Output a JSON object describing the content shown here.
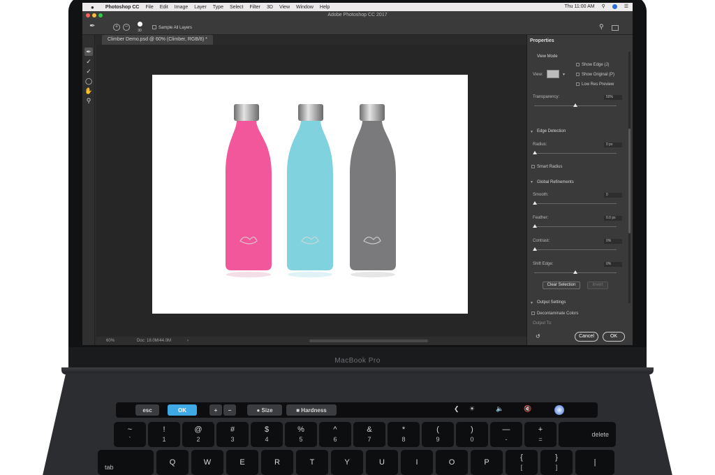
{
  "menubar": {
    "apple": "",
    "app_name": "Photoshop CC",
    "items": [
      "File",
      "Edit",
      "Image",
      "Layer",
      "Type",
      "Select",
      "Filter",
      "3D",
      "View",
      "Window",
      "Help"
    ],
    "clock": "Thu 11:00 AM"
  },
  "window": {
    "title": "Adobe Photoshop CC 2017",
    "light_colors": [
      "#fc605b",
      "#fdbc40",
      "#34c84a"
    ]
  },
  "options_bar": {
    "brush_size": "30",
    "sample_all_layers": "Sample All Layers"
  },
  "tools": [
    "quick-selection",
    "refine-edge-brush",
    "brush",
    "lasso",
    "hand",
    "zoom"
  ],
  "document": {
    "tab_title": "Climber Demo.psd @ 60% (Climber, RGB/8) *",
    "zoom": "60%",
    "doc_info": "Doc: 18.0M/44.0M"
  },
  "canvas": {
    "bottles": [
      {
        "name": "pink",
        "color": "#f1579a"
      },
      {
        "name": "teal",
        "color": "#7fd2de"
      },
      {
        "name": "gray",
        "color": "#7a7a7c"
      }
    ]
  },
  "properties": {
    "title": "Properties",
    "view_mode": {
      "heading": "View Mode",
      "view_label": "View:",
      "show_edge": "Show Edge (J)",
      "show_original": "Show Original (P)",
      "low_res_preview": "Low Res Preview"
    },
    "transparency": {
      "label": "Transparency:",
      "value": "50%",
      "level": 0.5
    },
    "edge_detection": {
      "heading": "Edge Detection",
      "radius_label": "Radius:",
      "radius_value": "0 px",
      "smart_radius": "Smart Radius"
    },
    "global_refinements": {
      "heading": "Global Refinements",
      "smooth_label": "Smooth:",
      "smooth_value": "0",
      "feather_label": "Feather:",
      "feather_value": "0.0 px",
      "contrast_label": "Contrast:",
      "contrast_value": "0%",
      "shift_edge_label": "Shift Edge:",
      "shift_edge_value": "0%",
      "shift_level": 0.5
    },
    "clear_selection": "Clear Selection",
    "invert": "Invert",
    "output_settings": {
      "heading": "Output Settings",
      "decontaminate": "Decontaminate Colors",
      "output_to": "Output To:"
    },
    "cancel": "Cancel",
    "ok": "OK"
  },
  "laptop": {
    "brand": "MacBook Pro"
  },
  "touchbar": {
    "esc": "esc",
    "ok": "OK",
    "size": "Size",
    "hardness": "Hardness"
  },
  "keyboard": {
    "number_row": [
      {
        "top": "~",
        "bottom": "`"
      },
      {
        "top": "!",
        "bottom": "1"
      },
      {
        "top": "@",
        "bottom": "2"
      },
      {
        "top": "#",
        "bottom": "3"
      },
      {
        "top": "$",
        "bottom": "4"
      },
      {
        "top": "%",
        "bottom": "5"
      },
      {
        "top": "^",
        "bottom": "6"
      },
      {
        "top": "&",
        "bottom": "7"
      },
      {
        "top": "*",
        "bottom": "8"
      },
      {
        "top": "(",
        "bottom": "9"
      },
      {
        "top": ")",
        "bottom": "0"
      },
      {
        "top": "—",
        "bottom": "-"
      },
      {
        "top": "+",
        "bottom": "="
      }
    ],
    "delete": "delete",
    "tab": "tab",
    "letter_row": [
      "Q",
      "W",
      "E",
      "R",
      "T",
      "Y",
      "U",
      "I",
      "O",
      "P"
    ],
    "brackets": [
      {
        "top": "{",
        "bottom": "["
      },
      {
        "top": "}",
        "bottom": "]"
      }
    ]
  }
}
